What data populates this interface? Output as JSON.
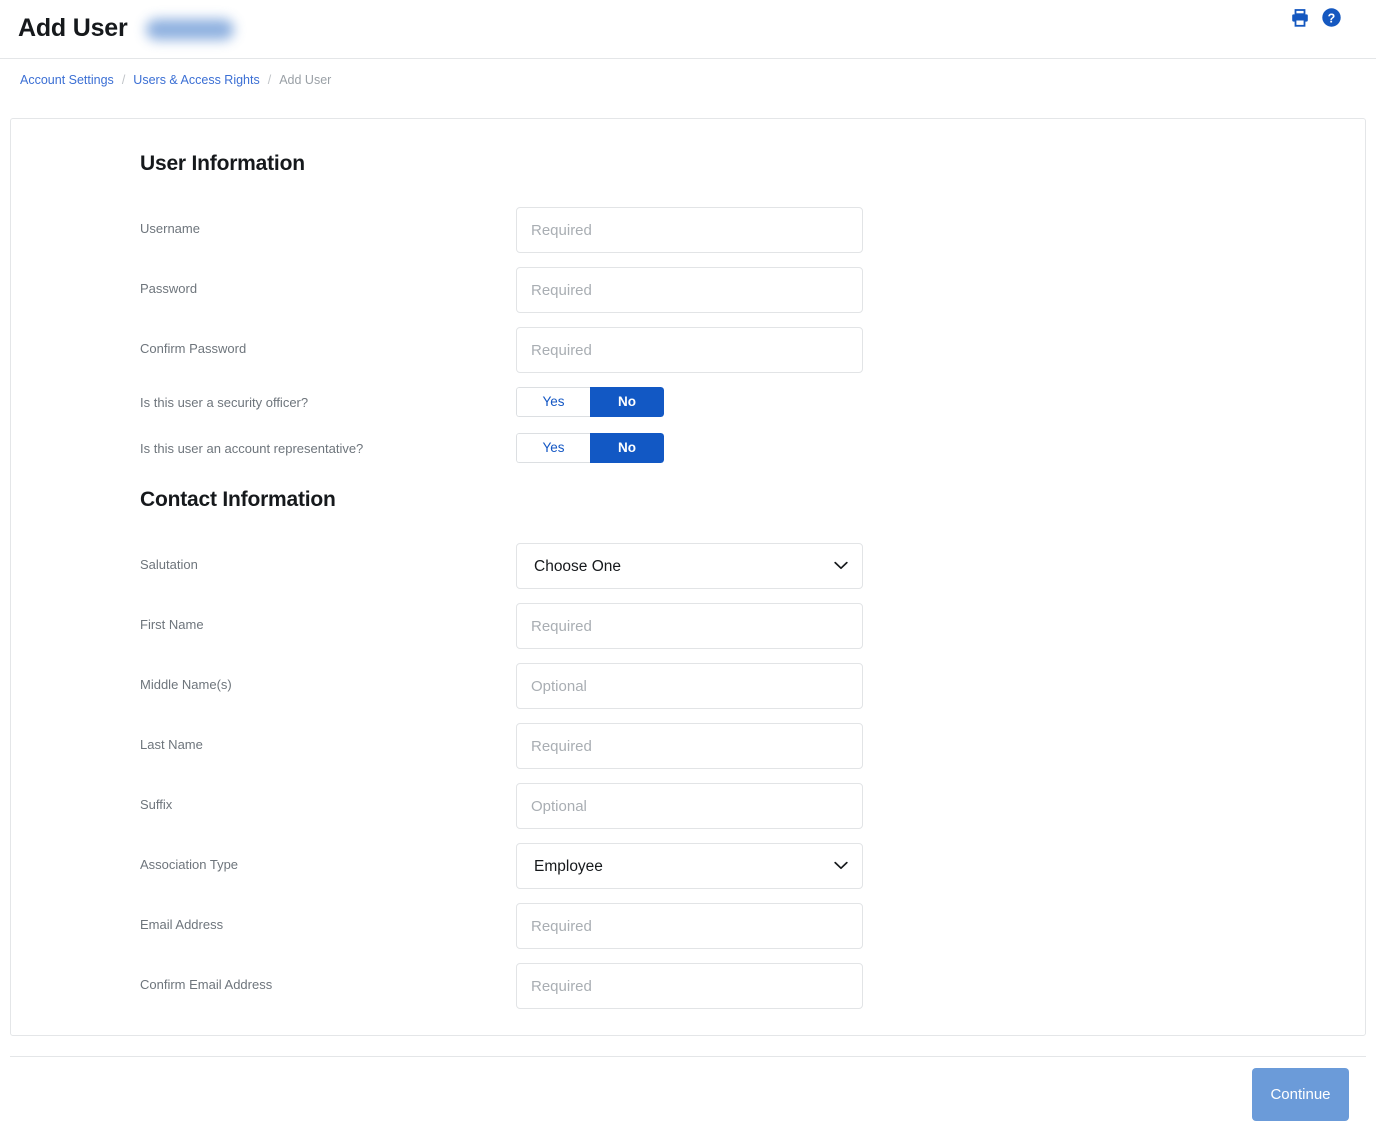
{
  "header": {
    "title": "Add User",
    "redacted_label": "",
    "icons": [
      {
        "name": "print-icon",
        "label": "Print"
      },
      {
        "name": "help-icon",
        "label": "Help"
      }
    ],
    "icon_color": "#1558c0"
  },
  "breadcrumb": {
    "separator": "/",
    "items": [
      {
        "label": "Account Settings",
        "current": false
      },
      {
        "label": "Users & Access Rights",
        "current": false
      },
      {
        "label": "Add User",
        "current": true
      }
    ]
  },
  "sections": {
    "user_information": {
      "title": "User Information",
      "fields": [
        {
          "label": "Username",
          "type": "text",
          "value": "",
          "placeholder": "Required"
        },
        {
          "label": "Password",
          "type": "password",
          "value": "",
          "placeholder": "Required"
        },
        {
          "label": "Confirm Password",
          "type": "password",
          "value": "",
          "placeholder": "Required"
        }
      ],
      "toggles": [
        {
          "label": "Is this user a security officer?",
          "options": [
            "Yes",
            "No"
          ],
          "selected": "No"
        },
        {
          "label": "Is this user an account representative?",
          "options": [
            "Yes",
            "No"
          ],
          "selected": "No"
        }
      ]
    },
    "contact_information": {
      "title": "Contact Information",
      "fields": [
        {
          "label": "Salutation",
          "type": "select",
          "value": "Choose One",
          "options": [
            "Choose One"
          ]
        },
        {
          "label": "First Name",
          "type": "text",
          "value": "",
          "placeholder": "Required"
        },
        {
          "label": "Middle Name(s)",
          "type": "text",
          "value": "",
          "placeholder": "Optional"
        },
        {
          "label": "Last Name",
          "type": "text",
          "value": "",
          "placeholder": "Required"
        },
        {
          "label": "Suffix",
          "type": "text",
          "value": "",
          "placeholder": "Optional"
        },
        {
          "label": "Association Type",
          "type": "select",
          "value": "Employee",
          "options": [
            "Employee"
          ]
        },
        {
          "label": "Email Address",
          "type": "text",
          "value": "",
          "placeholder": "Required"
        },
        {
          "label": "Confirm Email Address",
          "type": "text",
          "value": "",
          "placeholder": "Required"
        }
      ]
    }
  },
  "footer": {
    "continue_label": "Continue",
    "continue_color": "#6b9bd9"
  },
  "colors": {
    "accent_blue": "#1258c0",
    "link_blue": "#3b6fd4",
    "label_gray": "#6e757c",
    "border_gray": "#e4e6e8"
  }
}
